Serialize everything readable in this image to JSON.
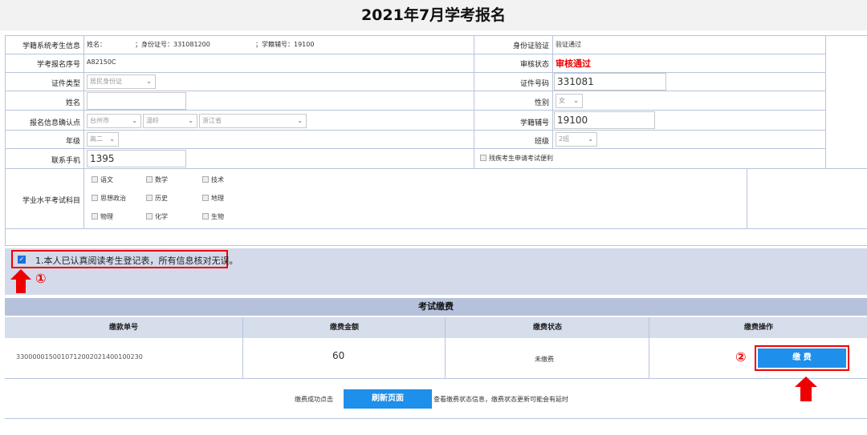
{
  "page_title": "2021年7月学考报名",
  "form": {
    "row1": {
      "label": "学籍系统考生信息",
      "value": "姓名：",
      "id_label": "；身份证号：331081200",
      "school_label": "；学籍辅号：19100",
      "right_label": "身份证验证",
      "right_value": "验证通过"
    },
    "row2": {
      "label": "学考报名序号",
      "value": "A82150C",
      "right_label": "审核状态",
      "right_value": "审核通过"
    },
    "row3": {
      "label": "证件类型",
      "select": "居民身份证",
      "right_label": "证件号码",
      "right_value": "331081"
    },
    "row4": {
      "label": "姓名",
      "right_label": "性别",
      "right_select": "女"
    },
    "row5": {
      "label": "报名信息确认点",
      "sel1": "台州市",
      "sel2": "温岭",
      "sel3": "浙江省",
      "right_label": "学籍辅号",
      "right_value": "19100"
    },
    "row6": {
      "label": "年级",
      "select": "高二",
      "right_label": "班级",
      "right_select": "2班"
    },
    "row7": {
      "label": "联系手机",
      "value": "1395",
      "right_check_label": "残疾考生申请考试便利"
    },
    "subjects": {
      "label": "学业水平考试科目",
      "items": [
        "语文",
        "数学",
        "技术",
        "思想政治",
        "历史",
        "地理",
        "物理",
        "化学",
        "生物"
      ]
    }
  },
  "confirm": {
    "text": "1.本人已认真阅读考生登记表，所有信息核对无误。",
    "marker": "①"
  },
  "fee": {
    "title": "考试缴费",
    "columns": [
      "缴款单号",
      "缴费金额",
      "缴费状态",
      "缴费操作"
    ],
    "row": {
      "order_no": "3300000150010712002021400100230",
      "amount": "60",
      "status": "未缴费",
      "pay_button": "缴  费",
      "marker": "②"
    },
    "refresh_prefix": "缴费成功点击",
    "refresh_button": "刷新页面",
    "refresh_suffix": "查看缴费状态信息，缴费状态更新可能会有延时"
  }
}
